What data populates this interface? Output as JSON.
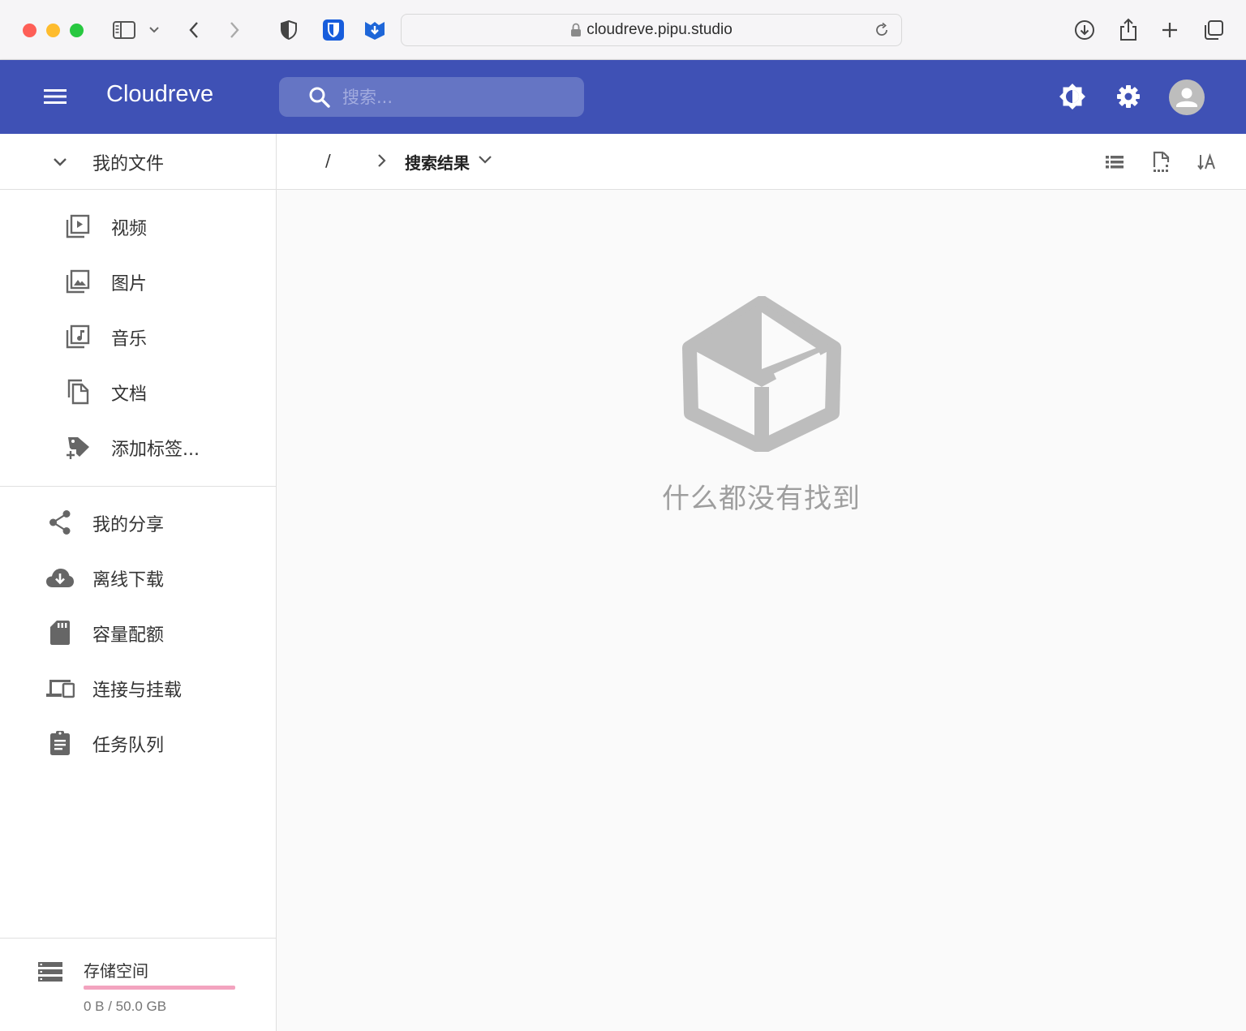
{
  "browser": {
    "url": "cloudreve.pipu.studio"
  },
  "appbar": {
    "title": "Cloudreve",
    "search_placeholder": "搜索..."
  },
  "sidebar": {
    "my_files": "我的文件",
    "sub_items": [
      {
        "label": "视频",
        "icon": "video-library-icon"
      },
      {
        "label": "图片",
        "icon": "photo-library-icon"
      },
      {
        "label": "音乐",
        "icon": "music-library-icon"
      },
      {
        "label": "文档",
        "icon": "file-copy-icon"
      },
      {
        "label": "添加标签...",
        "icon": "add-tag-icon"
      }
    ],
    "nav_items": [
      {
        "label": "我的分享",
        "icon": "share-icon"
      },
      {
        "label": "离线下载",
        "icon": "cloud-download-icon"
      },
      {
        "label": "容量配额",
        "icon": "sd-card-icon"
      },
      {
        "label": "连接与挂载",
        "icon": "devices-icon"
      },
      {
        "label": "任务队列",
        "icon": "assignment-icon"
      }
    ],
    "storage": {
      "title": "存储空间",
      "used_text": "0 B / 50.0 GB",
      "used_fraction": 0
    }
  },
  "breadcrumb": {
    "root": "/",
    "current": "搜索结果"
  },
  "empty_state": {
    "message": "什么都没有找到"
  },
  "colors": {
    "primary": "#3f51b5",
    "accent": "#f50057",
    "empty_icon": "#bdbdbd"
  }
}
